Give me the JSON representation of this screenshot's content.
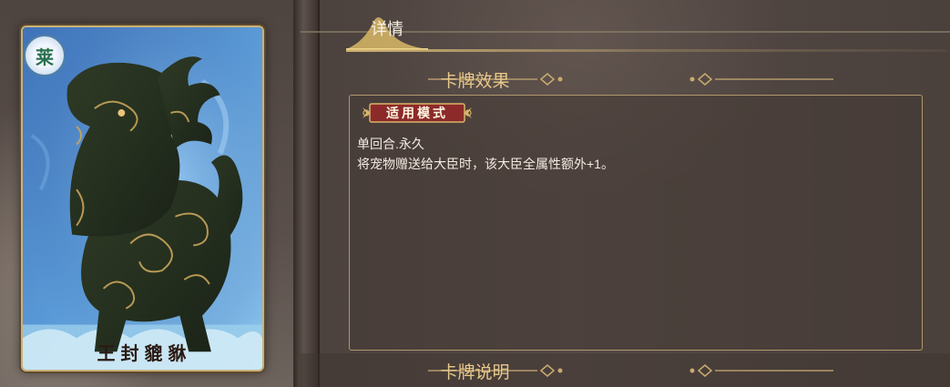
{
  "card": {
    "badge_char": "莱",
    "name": "王封貔貅"
  },
  "tabs": [
    {
      "label": "详情"
    }
  ],
  "sections": {
    "effect_title": "卡牌效果",
    "mode_badge": "适用模式",
    "desc_line1": "单回合.永久",
    "desc_line2": "将宠物赠送给大臣时，该大臣全属性额外+1。",
    "explain_title": "卡牌说明"
  },
  "colors": {
    "accent_gold": "#e8c98a",
    "card_border": "#c9b27a",
    "badge_red": "#8c2a2a"
  }
}
